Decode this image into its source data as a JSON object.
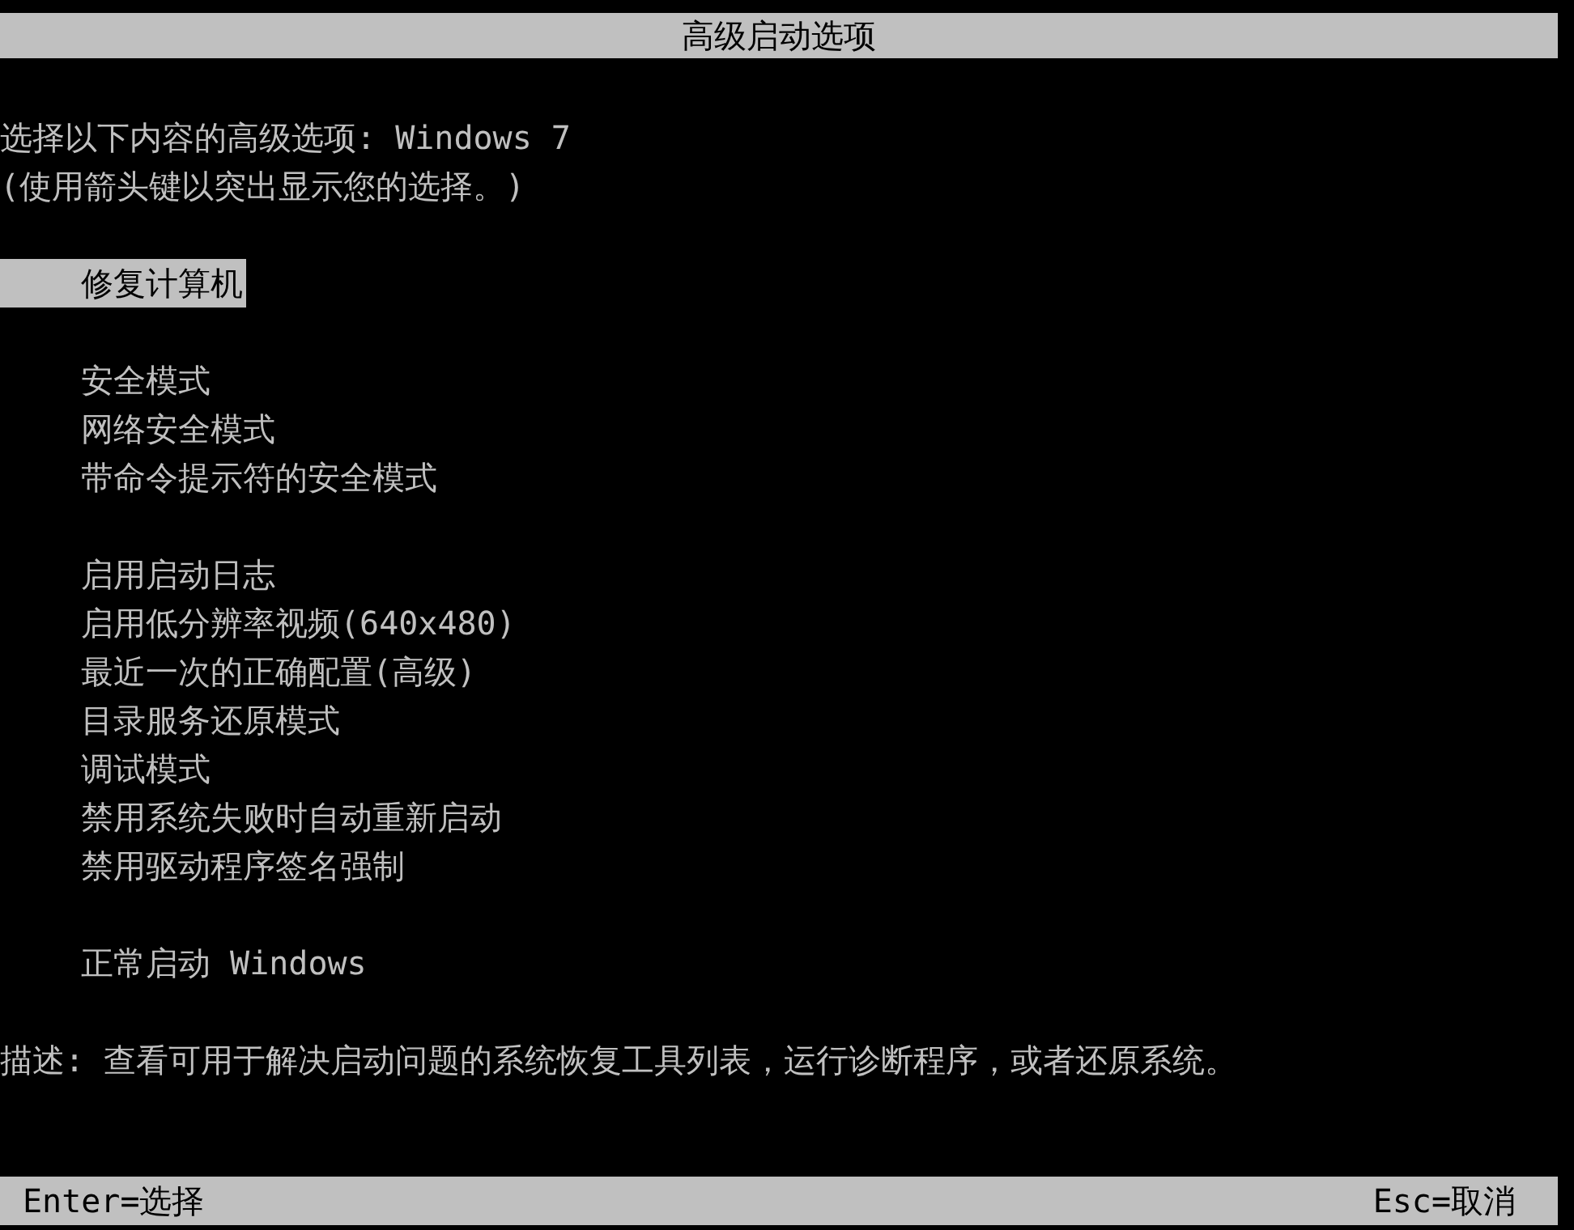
{
  "title": "高级启动选项",
  "prompt": "选择以下内容的高级选项: Windows 7",
  "hint": "(使用箭头键以突出显示您的选择。)",
  "option_groups": [
    [
      {
        "label": "修复计算机",
        "selected": true
      }
    ],
    [
      {
        "label": "安全模式",
        "selected": false
      },
      {
        "label": "网络安全模式",
        "selected": false
      },
      {
        "label": "带命令提示符的安全模式",
        "selected": false
      }
    ],
    [
      {
        "label": "启用启动日志",
        "selected": false
      },
      {
        "label": "启用低分辨率视频(640x480)",
        "selected": false
      },
      {
        "label": "最近一次的正确配置(高级)",
        "selected": false
      },
      {
        "label": "目录服务还原模式",
        "selected": false
      },
      {
        "label": "调试模式",
        "selected": false
      },
      {
        "label": "禁用系统失败时自动重新启动",
        "selected": false
      },
      {
        "label": "禁用驱动程序签名强制",
        "selected": false
      }
    ],
    [
      {
        "label": "正常启动 Windows",
        "selected": false
      }
    ]
  ],
  "description": "描述: 查看可用于解决启动问题的系统恢复工具列表，运行诊断程序，或者还原系统。",
  "status_bar": {
    "left": "Enter=选择",
    "right": "Esc=取消"
  }
}
